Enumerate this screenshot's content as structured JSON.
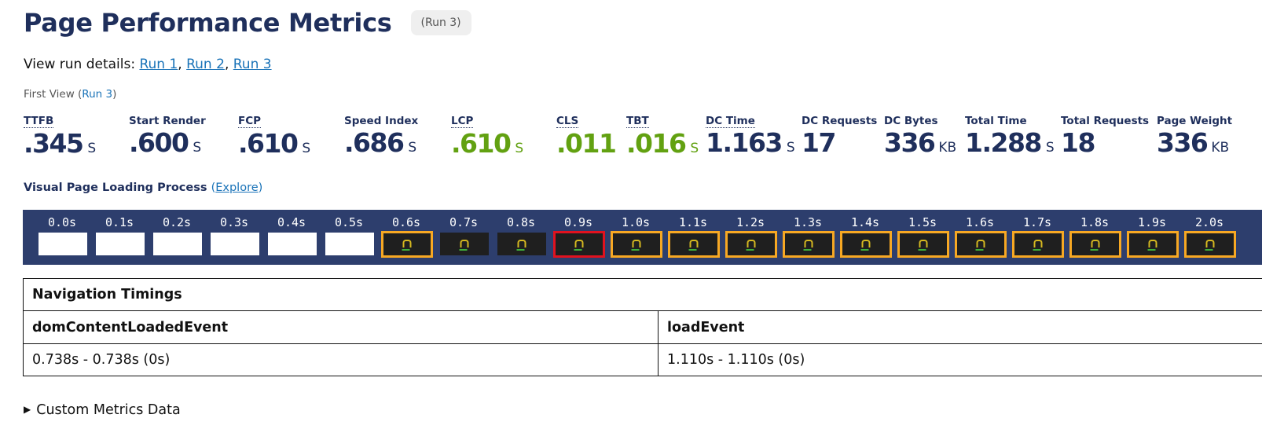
{
  "header": {
    "title": "Page Performance Metrics",
    "run_badge": "(Run 3)"
  },
  "run_details": {
    "prefix": "View run details:",
    "sep": ",",
    "links": [
      "Run 1",
      "Run 2",
      "Run 3"
    ]
  },
  "first_view": {
    "prefix": "First View (",
    "link": "Run 3",
    "suffix": ")"
  },
  "metrics": [
    {
      "label": "TTFB",
      "value": ".345",
      "unit": "S"
    },
    {
      "label": "Start Render",
      "value": ".600",
      "unit": "S"
    },
    {
      "label": "FCP",
      "value": ".610",
      "unit": "S"
    },
    {
      "label": "Speed Index",
      "value": ".686",
      "unit": "S"
    },
    {
      "label": "LCP",
      "value": ".610",
      "unit": "S"
    },
    {
      "label": "CLS",
      "value": ".011",
      "unit": ""
    },
    {
      "label": "TBT",
      "value": ".016",
      "unit": "S"
    },
    {
      "label": "DC Time",
      "value": "1.163",
      "unit": "S"
    },
    {
      "label": "DC Requests",
      "value": "17",
      "unit": ""
    },
    {
      "label": "DC Bytes",
      "value": "336",
      "unit": "KB"
    },
    {
      "label": "Total Time",
      "value": "1.288",
      "unit": "S"
    },
    {
      "label": "Total Requests",
      "value": "18",
      "unit": ""
    },
    {
      "label": "Page Weight",
      "value": "336",
      "unit": "KB"
    }
  ],
  "visual_progress": {
    "title": "Visual Page Loading Process",
    "explore_open": "(",
    "explore_link": "Explore",
    "explore_close": ")"
  },
  "filmstrip": [
    {
      "time": "0.0s",
      "state": "blank"
    },
    {
      "time": "0.1s",
      "state": "blank"
    },
    {
      "time": "0.2s",
      "state": "blank"
    },
    {
      "time": "0.3s",
      "state": "blank"
    },
    {
      "time": "0.4s",
      "state": "blank"
    },
    {
      "time": "0.5s",
      "state": "blank"
    },
    {
      "time": "0.6s",
      "state": "changed"
    },
    {
      "time": "0.7s",
      "state": "rendered"
    },
    {
      "time": "0.8s",
      "state": "rendered"
    },
    {
      "time": "0.9s",
      "state": "lcp"
    },
    {
      "time": "1.0s",
      "state": "changed"
    },
    {
      "time": "1.1s",
      "state": "changed"
    },
    {
      "time": "1.2s",
      "state": "changed"
    },
    {
      "time": "1.3s",
      "state": "changed"
    },
    {
      "time": "1.4s",
      "state": "changed"
    },
    {
      "time": "1.5s",
      "state": "changed"
    },
    {
      "time": "1.6s",
      "state": "changed"
    },
    {
      "time": "1.7s",
      "state": "changed"
    },
    {
      "time": "1.8s",
      "state": "changed"
    },
    {
      "time": "1.9s",
      "state": "changed"
    },
    {
      "time": "2.0s",
      "state": "changed"
    }
  ],
  "navigation_timings": {
    "caption": "Navigation Timings",
    "headers": [
      "domContentLoadedEvent",
      "loadEvent"
    ],
    "row": [
      "0.738s - 0.738s (0s)",
      "1.110s - 1.110s (0s)"
    ]
  },
  "custom_metrics": {
    "label": "Custom Metrics Data"
  },
  "colors": {
    "navy": "#1f2f5c",
    "good_green": "#62a111",
    "link_blue": "#1a73b8",
    "filmstrip_bg": "#2d3e6d",
    "visual_change_border": "#f7a823",
    "lcp_border": "#e0121f"
  }
}
